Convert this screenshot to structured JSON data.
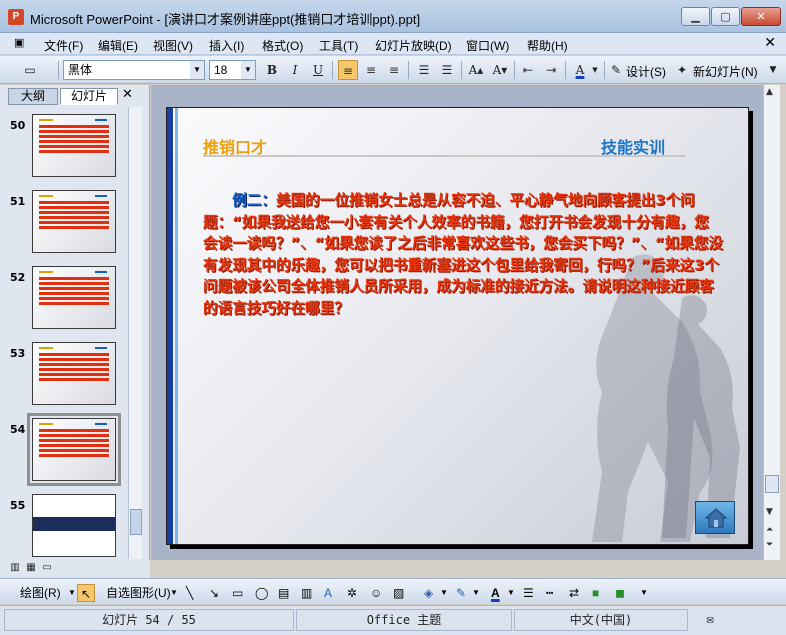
{
  "window": {
    "app_icon_letter": "P",
    "title": "Microsoft PowerPoint - [演讲口才案例讲座ppt(推销口才培训ppt).ppt]",
    "min_glyph": "▁",
    "max_glyph": "▢",
    "close_glyph": "✕"
  },
  "menu": {
    "items": [
      "文件(F)",
      "编辑(E)",
      "视图(V)",
      "插入(I)",
      "格式(O)",
      "工具(T)",
      "幻灯片放映(D)",
      "窗口(W)",
      "帮助(H)"
    ],
    "close_doc": "✕"
  },
  "toolbar": {
    "font_name": "黑体",
    "font_size": "18",
    "bold": "B",
    "italic": "I",
    "underline": "U",
    "design_label": "设计(S)",
    "new_slide_label": "新幻灯片(N)"
  },
  "panel": {
    "tab_outline": "大纲",
    "tab_slides": "幻灯片",
    "close": "✕",
    "thumbnails": [
      {
        "num": "50"
      },
      {
        "num": "51"
      },
      {
        "num": "52"
      },
      {
        "num": "53"
      },
      {
        "num": "54"
      },
      {
        "num": "55"
      }
    ]
  },
  "slide": {
    "header_left": "推销口才",
    "header_right": "技能实训",
    "body_lead": "例二：",
    "body_text": "美国的一位推销女士总是从容不迫、平心静气地向顾客提出3个问题：“如果我送给您一小套有关个人效率的书籍，您打开书会发现十分有趣，您会读一读吗？”、“如果您读了之后非常喜欢这些书，您会买下吗？”、“如果您没有发现其中的乐趣，您可以把书重新塞进这个包里给我寄回，行吗？”后来这3个问题被该公司全体推销人员所采用，成为标准的接近方法。请说明这种接近顾客的语言技巧好在哪里？"
  },
  "drawbar": {
    "draw_label": "绘图(R)",
    "autoshape_label": "自选图形(U)"
  },
  "status": {
    "slide_pos": "幻灯片 54 / 55",
    "theme": "Office 主题",
    "language": "中文(中国)"
  },
  "colors": {
    "accent_blue": "#1c75c4",
    "body_red": "#e8360e",
    "header_gold": "#e8a010"
  }
}
